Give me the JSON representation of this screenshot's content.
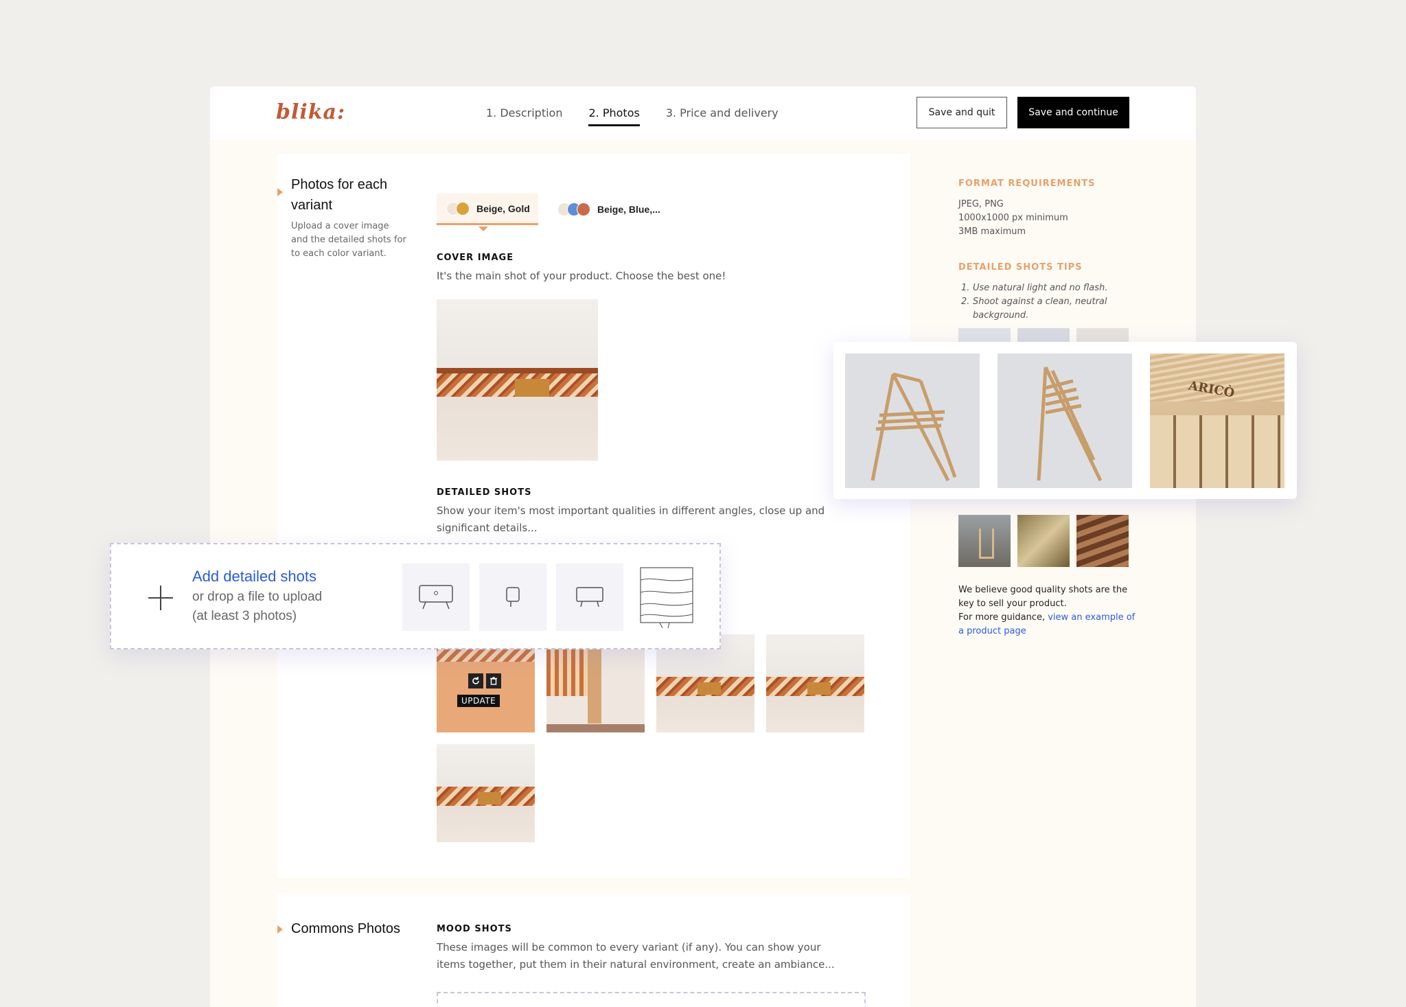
{
  "brand": {
    "logo": "blika:"
  },
  "steps": [
    {
      "label": "1. Description"
    },
    {
      "label": "2. Photos"
    },
    {
      "label": "3. Price and delivery"
    }
  ],
  "actions": {
    "save_quit": "Save and quit",
    "save_continue": "Save and continue"
  },
  "variant_section": {
    "title": "Photos for each variant",
    "subtitle": "Upload a cover image and the detailed shots for to each color variant.",
    "tabs": [
      {
        "label": "Beige, Gold",
        "colors": [
          "#efe4d8",
          "#d9a23a"
        ]
      },
      {
        "label": "Beige, Blue,...",
        "colors": [
          "#efe4d8",
          "#5b8fd8",
          "#c96b4a"
        ]
      }
    ],
    "cover": {
      "label": "COVER IMAGE",
      "desc": "It's the main shot of your product. Choose the best one!"
    },
    "detailed": {
      "label": "DETAILED SHOTS",
      "desc": "Show your item's most important qualities in different angles, close up and significant details..."
    },
    "dropzone": {
      "link": "Add detailed shots",
      "line1": "or drop a file to upload",
      "line2": "(at least 3 photos)"
    },
    "update_tip": "UPDATE"
  },
  "commons_section": {
    "title": "Commons Photos",
    "mood": {
      "label": "MOOD SHOTS",
      "desc": "These images will be common to every variant (if any). You can show your items together, put them in their natural environment, create an ambiance..."
    }
  },
  "sidebar": {
    "format_title": "FORMAT REQUIREMENTS",
    "format_lines": [
      "JPEG, PNG",
      "1000x1000 px minimum",
      "3MB maximum"
    ],
    "tips_title": "DETAILED SHOTS TIPS",
    "tips": [
      "Use natural light and no flash.",
      "Shoot against a clean, neutral",
      "background."
    ],
    "tip_nums": [
      "1.",
      "2."
    ],
    "note1": "We believe good quality shots are the",
    "note2": "key to sell your product.",
    "note3": "For more guidance,",
    "note_link1": "view an example of",
    "note_link2": "a product page"
  },
  "popover": {
    "brand_stamp": "ARICÒ"
  },
  "colors": {
    "accent": "#e8a06b",
    "brand": "#c25a35",
    "link": "#2a5bd7"
  }
}
